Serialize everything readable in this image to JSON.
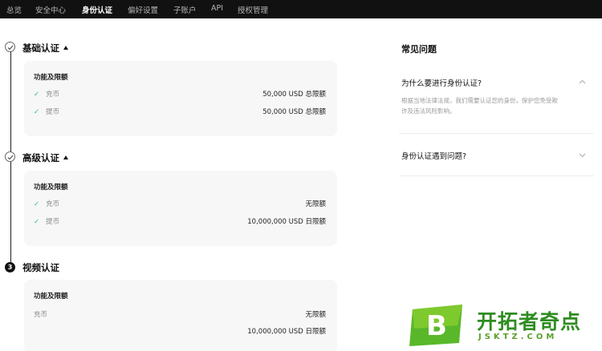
{
  "nav": {
    "items": [
      "总览",
      "安全中心",
      "身份认证",
      "偏好设置",
      "子账户",
      "API",
      "授权管理"
    ],
    "active_index": 2
  },
  "sections": [
    {
      "title": "基础认证",
      "step_state": "done",
      "card": {
        "heading": "功能及限额",
        "rows": [
          {
            "label": "充币",
            "value": "50,000 USD 总限额",
            "checked": true
          },
          {
            "label": "提币",
            "value": "50,000 USD 总限额",
            "checked": true
          }
        ]
      }
    },
    {
      "title": "高级认证",
      "step_state": "done",
      "card": {
        "heading": "功能及限额",
        "rows": [
          {
            "label": "充币",
            "value": "无限额",
            "checked": true
          },
          {
            "label": "提币",
            "value": "10,000,000 USD 日限额",
            "checked": true
          }
        ]
      }
    },
    {
      "title": "视频认证",
      "step_state": "pending",
      "step_number": "3",
      "card": {
        "heading": "功能及限额",
        "rows": [
          {
            "label": "充币",
            "value": "无限额",
            "checked": false
          },
          {
            "label": "",
            "value": "10,000,000 USD 日限额",
            "checked": false
          }
        ]
      }
    }
  ],
  "faq": {
    "title": "常见问题",
    "items": [
      {
        "question": "为什么要进行身份认证?",
        "answer": "根据当地法律法规，我们需要认证您的身份，保护您免受欺诈及违法风险影响。",
        "expanded": true
      },
      {
        "question": "身份认证遇到问题?",
        "answer": "",
        "expanded": false
      }
    ]
  },
  "watermark": {
    "logo_letter": "B",
    "name": "开拓者奇点",
    "domain": "JSKTZ.COM"
  },
  "colors": {
    "nav_bg": "#111111",
    "check_green": "#2fbf71",
    "card_bg": "#f7f7f7",
    "watermark_green": "#2f8c22"
  }
}
